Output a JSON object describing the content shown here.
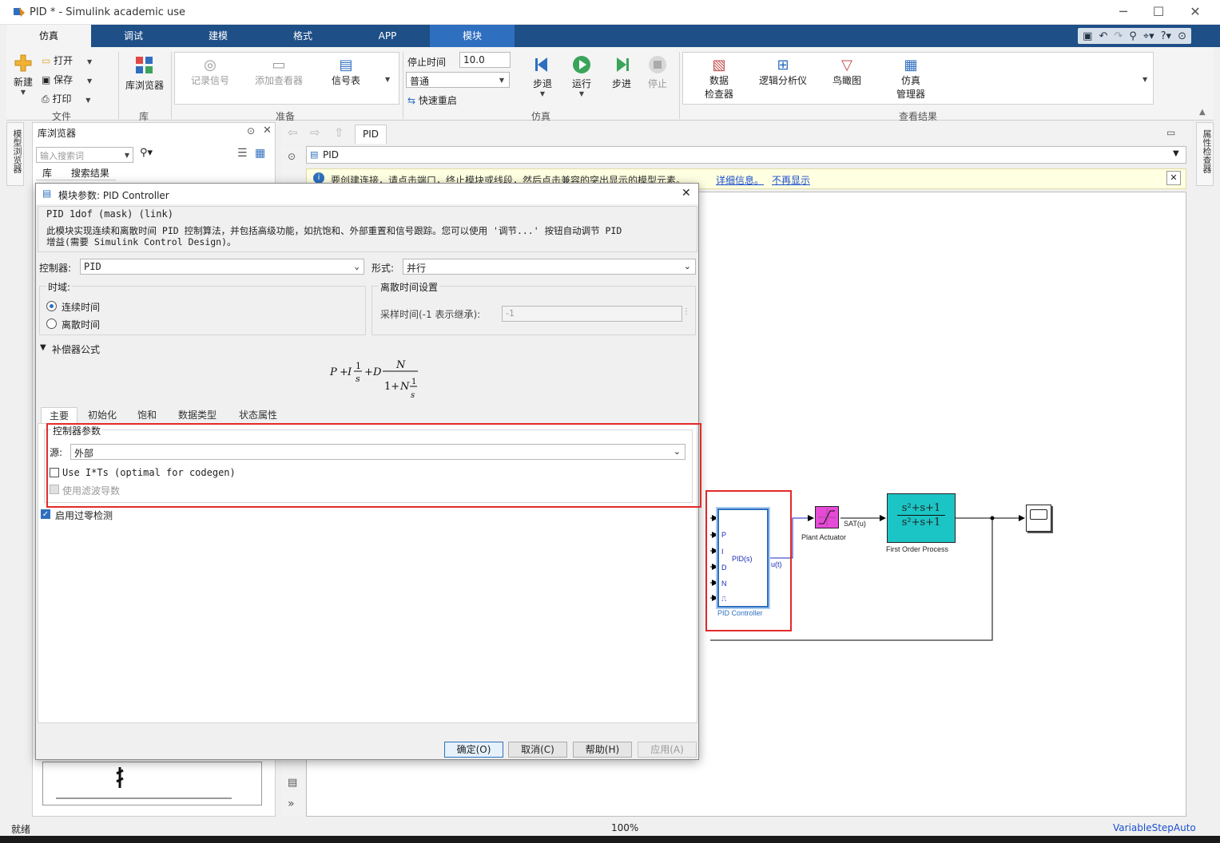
{
  "window": {
    "title": "PID * - Simulink academic use",
    "minimize": "─",
    "maximize": "☐",
    "close": "✕"
  },
  "ribbon_tabs": [
    "仿真",
    "调试",
    "建模",
    "格式",
    "APP",
    "模块"
  ],
  "file": {
    "new": "新建",
    "open": "打开",
    "save": "保存",
    "print": "打印",
    "section": "文件"
  },
  "library": {
    "button": "库浏览器",
    "section": "库"
  },
  "prepare": {
    "log_signals": "记录信号",
    "add_viewer": "添加查看器",
    "signal_table": "信号表",
    "section": "准备"
  },
  "simulate": {
    "stop_time_label": "停止时间",
    "stop_time_value": "10.0",
    "mode": "普通",
    "fast_restart": "快速重启",
    "step_back": "步退",
    "run": "运行",
    "step_forward": "步进",
    "stop": "停止",
    "section": "仿真"
  },
  "review": {
    "data_inspector_1": "数据",
    "data_inspector_2": "检查器",
    "logic_analyzer": "逻辑分析仪",
    "birdseye": "鸟瞰图",
    "sim_manager_1": "仿真",
    "sim_manager_2": "管理器",
    "section": "查看结果"
  },
  "side_strips": {
    "model_browser": "模型浏览器",
    "property_inspector": "属性检查器"
  },
  "lib_browser": {
    "title": "库浏览器",
    "search_placeholder": "输入搜索词",
    "tab_lib": "库",
    "tab_results": "搜索结果"
  },
  "canvas": {
    "tab": "PID",
    "address": "PID",
    "info_text": "要创建连接，请点击端口，终止模块或线段，然后点击兼容的突出显示的模型元素。",
    "info_link1": "详细信息。",
    "info_link2": "不再显示"
  },
  "diagram": {
    "pid_ports": [
      "P",
      "I",
      "D",
      "N"
    ],
    "pid_inner": "PID(s)",
    "pid_out": "u(t)",
    "pid_name": "PID Controller",
    "sat_out": "SAT(u)",
    "sat_name": "Plant Actuator",
    "tf_name": "First Order Process",
    "tf_num": "s²+s+1",
    "tf_den": "s²+s+1"
  },
  "status": {
    "left": "就绪",
    "zoom": "100%",
    "solver": "VariableStepAuto"
  },
  "dialog": {
    "title": "模块参数: PID Controller",
    "header": "PID 1dof (mask) (link)",
    "description_1": "此模块实现连续和离散时间 PID 控制算法，并包括高级功能，如抗饱和、外部重置和信号跟踪。您可以使用 '调节...' 按钮自动调节 PID",
    "description_2": "增益(需要 Simulink Control Design)。",
    "controller_label": "控制器:",
    "controller_value": "PID",
    "form_label": "形式:",
    "form_value": "并行",
    "time_domain_label": "时域:",
    "continuous": "连续时间",
    "discrete": "离散时间",
    "discrete_settings_label": "离散时间设置",
    "sample_time_label": "采样时间(-1 表示继承):",
    "sample_time_value": "-1",
    "compensator_label": "补偿器公式",
    "tabs": [
      "主要",
      "初始化",
      "饱和",
      "数据类型",
      "状态属性"
    ],
    "params_group": "控制器参数",
    "source_label": "源:",
    "source_value": "外部",
    "use_its": "Use I*Ts (optimal for codegen)",
    "use_filter": "使用滤波导数",
    "zero_crossing": "启用过零检测",
    "ok": "确定(O)",
    "cancel": "取消(C)",
    "help": "帮助(H)",
    "apply": "应用(A)"
  },
  "colors": {
    "ribbon_blue": "#1e4f87",
    "module_tab": "#2f6fbf",
    "highlight_red": "#e32a2a",
    "saturation_block": "#e64ad6",
    "transfer_block": "#1cc5c5"
  }
}
